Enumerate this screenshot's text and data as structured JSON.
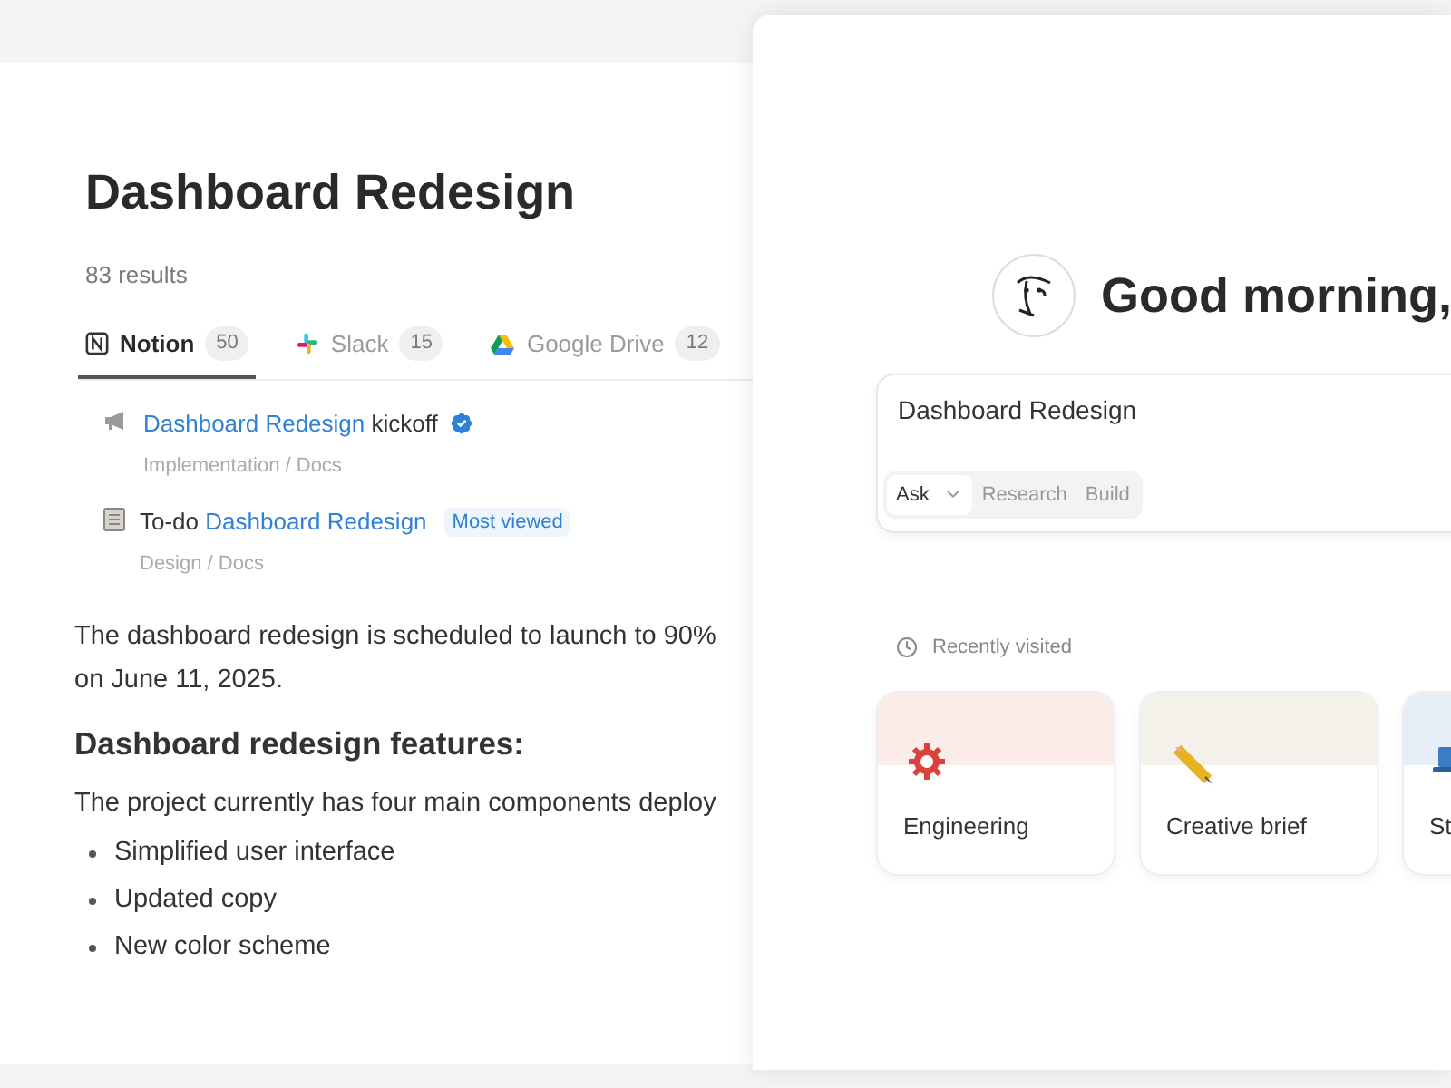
{
  "search_page": {
    "title": "Dashboard Redesign",
    "count": "83 results",
    "tabs": [
      {
        "kind": "notion",
        "label": "Notion",
        "count": "50",
        "selected": true
      },
      {
        "kind": "slack",
        "label": "Slack",
        "count": "15",
        "selected": false
      },
      {
        "kind": "drive",
        "label": "Google Drive",
        "count": "12",
        "selected": false
      }
    ],
    "results": [
      {
        "kind": "megaphone",
        "parts": [
          {
            "text": "Dashboard Redesign",
            "highlight": true
          },
          {
            "text": "kickoff",
            "highlight": false
          }
        ],
        "verified": true,
        "path": "Implementation / Docs"
      },
      {
        "kind": "page",
        "parts": [
          {
            "text": "To-do",
            "highlight": false
          },
          {
            "text": "Dashboard Redesign",
            "highlight": true
          }
        ],
        "verified": false,
        "tag": "Most viewed",
        "path": "Design / Docs"
      }
    ],
    "paragraph_1": "The dashboard redesign is scheduled to launch to 90% on June 11, 2025.",
    "heading": "Dashboard redesign features:",
    "paragraph_2": "The project currently has four main components deploy",
    "bullets": [
      "Simplified user interface",
      "Updated copy",
      "New color scheme"
    ]
  },
  "home_panel": {
    "greeting": "Good morning,",
    "prompt": {
      "value": "Dashboard Redesign",
      "modes": [
        {
          "label": "Ask",
          "selected": true
        },
        {
          "label": "Research",
          "selected": false
        },
        {
          "label": "Build",
          "selected": false
        }
      ]
    },
    "recent_label": "Recently visited",
    "cards": [
      {
        "kind": "gear",
        "title": "Engineering",
        "color": "#fbecea"
      },
      {
        "kind": "pencil",
        "title": "Creative brief",
        "color": "#f4f1ea"
      },
      {
        "kind": "laptop",
        "title": "St",
        "color": "#e6eef7"
      }
    ]
  }
}
